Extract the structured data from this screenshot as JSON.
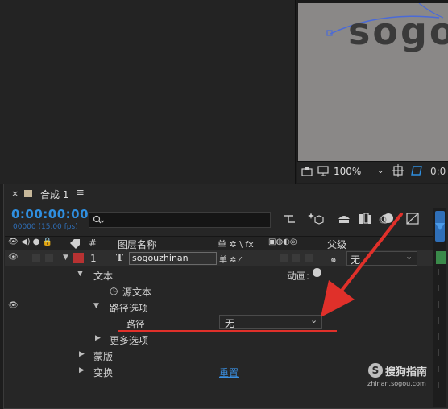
{
  "viewer": {
    "canvas_text": "sogo",
    "zoom": "100%",
    "time_partial": "0:0"
  },
  "timeline": {
    "comp_name": "合成 1",
    "timecode": "0:00:00:00",
    "fps": "00000 (15.00 fps)",
    "search_placeholder": ""
  },
  "columns": {
    "number": "#",
    "layer_name": "图层名称",
    "switches": "单 ✲ \\ fx",
    "parent": "父级"
  },
  "layer": {
    "index": "1",
    "type_glyph": "T",
    "name": "sogouzhinan",
    "parent_value": "无",
    "label_color": "#b83232"
  },
  "properties": {
    "text": "文本",
    "animate": "动画:",
    "source_text": "源文本",
    "path_options": "路径选项",
    "path": "路径",
    "path_value": "无",
    "more_options": "更多选项",
    "mask": "蒙版",
    "transform": "变换",
    "reset": "重置"
  },
  "watermark": {
    "brand": "搜狗指南",
    "url": "zhinan.sogou.com"
  },
  "colors": {
    "accent_blue": "#2f8fe0",
    "annotation_red": "#e0302a"
  }
}
